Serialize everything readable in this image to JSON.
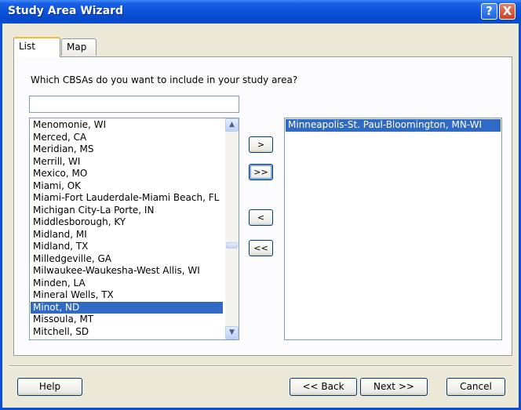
{
  "window": {
    "title": "Study Area Wizard",
    "help_glyph": "?",
    "close_glyph": "X"
  },
  "tabs": [
    {
      "label": "List"
    },
    {
      "label": "Map"
    }
  ],
  "question": "Which CBSAs do you want to include in your study area?",
  "filter": {
    "value": ""
  },
  "available_list": {
    "items": [
      "Menomonie, WI",
      "Merced, CA",
      "Meridian, MS",
      "Merrill, WI",
      "Mexico, MO",
      "Miami, OK",
      "Miami-Fort Lauderdale-Miami Beach, FL",
      "Michigan City-La Porte, IN",
      "Middlesborough, KY",
      "Midland, MI",
      "Midland, TX",
      "Milledgeville, GA",
      "Milwaukee-Waukesha-West Allis, WI",
      "Minden, LA",
      "Mineral Wells, TX",
      "Minot, ND",
      "Missoula, MT",
      "Mitchell, SD"
    ],
    "selected_index": 15,
    "scroll_up_glyph": "▲",
    "scroll_down_glyph": "▼"
  },
  "move_buttons": {
    "add": ">",
    "add_all": ">>",
    "remove": "<",
    "remove_all": "<<"
  },
  "selected_list": {
    "items": [
      "Minneapolis-St. Paul-Bloomington, MN-WI"
    ]
  },
  "footer": {
    "help": "Help",
    "back": "<< Back",
    "next": "Next >>",
    "cancel": "Cancel"
  },
  "colors": {
    "title_bar": "#0a4fd6",
    "selection": "#316ac5",
    "tab_highlight": "#f9b735"
  }
}
